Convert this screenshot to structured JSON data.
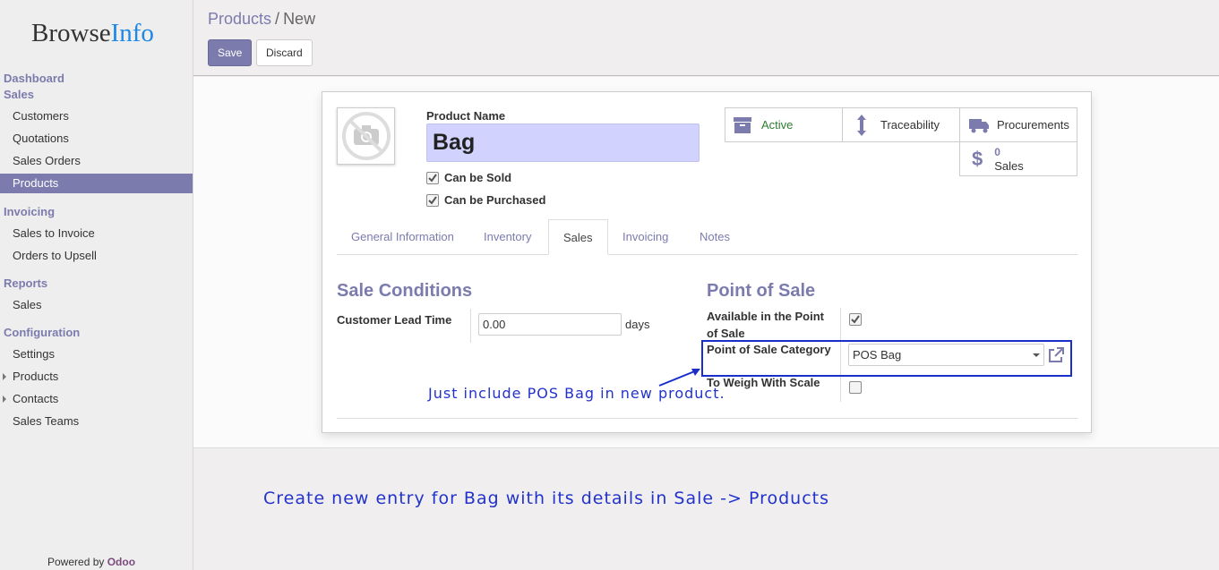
{
  "brand": {
    "logo_main": "Browse",
    "logo_accent": "Info",
    "powered_prefix": "Powered by",
    "powered_brand": "Odoo"
  },
  "sidebar": {
    "sections": [
      {
        "label": "Dashboard"
      },
      {
        "label": "Sales",
        "items": [
          "Customers",
          "Quotations",
          "Sales Orders",
          "Products"
        ]
      },
      {
        "label": "Invoicing",
        "items": [
          "Sales to Invoice",
          "Orders to Upsell"
        ]
      },
      {
        "label": "Reports",
        "items": [
          "Sales"
        ]
      },
      {
        "label": "Configuration",
        "items": [
          "Settings",
          "Products",
          "Contacts",
          "Sales Teams"
        ]
      }
    ],
    "active_item": "Products"
  },
  "breadcrumb": {
    "parent": "Products",
    "separator": "/",
    "current": "New"
  },
  "toolbar": {
    "save_label": "Save",
    "discard_label": "Discard"
  },
  "product": {
    "name_label": "Product Name",
    "name_value": "Bag",
    "can_be_sold_label": "Can be Sold",
    "can_be_sold": true,
    "can_be_purchased_label": "Can be Purchased",
    "can_be_purchased": true
  },
  "stat_buttons": {
    "active": "Active",
    "traceability": "Traceability",
    "procurements": "Procurements",
    "sales_count": "0",
    "sales_label": "Sales"
  },
  "tabs": [
    "General Information",
    "Inventory",
    "Sales",
    "Invoicing",
    "Notes"
  ],
  "active_tab": "Sales",
  "sale_conditions": {
    "title": "Sale Conditions",
    "lead_time_label": "Customer Lead Time",
    "lead_time_value": "0.00",
    "lead_time_unit": "days"
  },
  "point_of_sale": {
    "title": "Point of Sale",
    "available_label": "Available in the Point of Sale",
    "available": true,
    "category_label": "Point of Sale Category",
    "category_value": "POS Bag",
    "weigh_label": "To Weigh With Scale",
    "weigh": false
  },
  "annotations": {
    "pos_note": "Just include POS Bag in new product.",
    "bottom_note": "Create new entry for Bag with its details in Sale -> Products",
    "color": "#2233cc"
  },
  "colors": {
    "accent": "#7c7bad",
    "active_green": "#2e7d32",
    "annotation_blue": "#1a2ecc"
  }
}
